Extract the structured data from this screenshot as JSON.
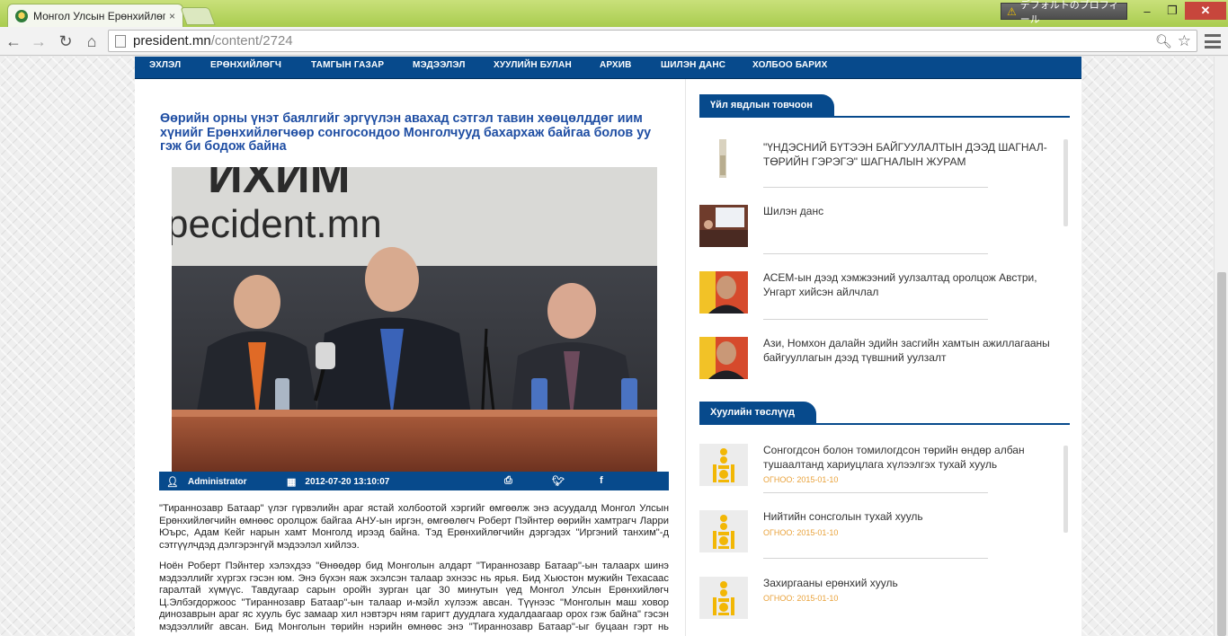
{
  "browser": {
    "tab_title": "Монгол Улсын Ерөнхийлөгч",
    "tab_close": "×",
    "profile_label": "デフォルトのプロフィール",
    "url_host": "president.mn",
    "url_path": "/content/2724"
  },
  "site": {
    "nav": [
      "ЭХЛЭЛ",
      "ЕРӨНХИЙЛӨГЧ",
      "ТАМГЫН ГАЗАР",
      "МЭДЭЭЛЭЛ",
      "ХУУЛИЙН БУЛАН",
      "АРХИВ",
      "ШИЛЭН ДАНС",
      "ХОЛБОО БАРИХ"
    ]
  },
  "article": {
    "title": "Өөрийн орны үнэт баялгийг эргүүлэн авахад сэтгэл тавин хөөцөлддөг иим хүнийг Ерөнхийлөгчөөр сонгосондоо Монголчууд бахархаж байгаа болов уу гэж би бодож байна",
    "photo_sign_text": "ресident.mn",
    "photo_sign_top": "ИХИМ",
    "author": "Administrator",
    "datetime": "2012-07-20 13:10:07",
    "paragraphs": [
      "\"Тираннозавр Батаар\" үлэг гүрвэлийн араг ястай холбоотой хэргийг өмгөөлж энэ асуудалд Монгол Улсын Ерөнхийлөгчийн өмнөөс оролцож байгаа  АНУ-ын иргэн, өмгөөлөгч Роберт Пэйнтер өөрийн хамтрагч Ларри Юърс, Адам Кейг нарын хамт Монголд ирээд байна. Тэд Ерөнхийлөгчийн дэргэдэх \"Иргэний танхим\"-д сэтгүүлчдэд дэлгэрэнгүй мэдээлэл хийлээ.",
      "Ноён Роберт Пэйнтер хэлэхдээ \"Өнөөдөр бид Монголын алдарт \"Тираннозавр Батаар\"-ын талаарх шинэ мэдээллийг хүргэх гэсэн юм. Энэ бүхэн яаж эхэлсэн талаар эхнээс нь ярья. Бид Хьюстон мужийн Техасаас гаралтай хүмүүс. Тавдугаар сарын орой̆н зурган цаг 30 минутын үед Монгол Улсын Ерөнхийлөгч Ц.Элбэгдоржоос \"Тираннозавр Батаар\"-ын талаар и-мэйл хүлээж авсан. Түүнээс \"Монголын маш ховор динозаврын араг яс хууль бус замаар хил нэвтэрч ням гаригт дуудлага худалдаагаар орох гэж байна\" гэсэн мэдээллийг  авсан. Бид Монголын төрийн нэрийн өмнөөс энэ \"Тираннозавр Батаар\"-ыг буцаан гэрт нь авчрахаас өмнө эрхүүлж авах талаар хэрэг"
    ]
  },
  "sidebar": {
    "section1_title": "Үйл явдлын товчоон",
    "events": [
      {
        "text": "\"ҮНДЭСНИЙ БҮТЭЭН БАЙГУУЛАЛТЫН ДЭЭД ШАГНАЛ-ТӨРИЙН ГЭРЭГЭ\" ШАГНАЛЫН ЖУРАМ"
      },
      {
        "text": "Шилэн данс"
      },
      {
        "text": "АСЕМ-ын дээд хэмжээний уулзалтад оролцож Австри, Унгарт хийсэн айлчлал"
      },
      {
        "text": "Ази, Номхон далайн эдийн засгийн хамтын ажиллагааны байгууллагын дээд түвшний уулзалт"
      }
    ],
    "section2_title": "Хуулийн төслүүд",
    "laws": [
      {
        "text": "Сонгогдсон болон томилогдсон төрийн өндөр албан тушаалтанд хариуцлага хүлээлгэх тухай хууль",
        "date": "ОГНОО: 2015-01-10"
      },
      {
        "text": "Нийтийн сонсголын тухай хууль",
        "date": "ОГНОО: 2015-01-10"
      },
      {
        "text": "Захиргааны ерөнхий хууль",
        "date": "ОГНОО: 2015-01-10"
      }
    ]
  },
  "colors": {
    "brand_blue": "#074a8c",
    "title_blue": "#1f4ea3",
    "date_orange": "#e9a23b",
    "chrome_green": "#a9cc4f"
  }
}
